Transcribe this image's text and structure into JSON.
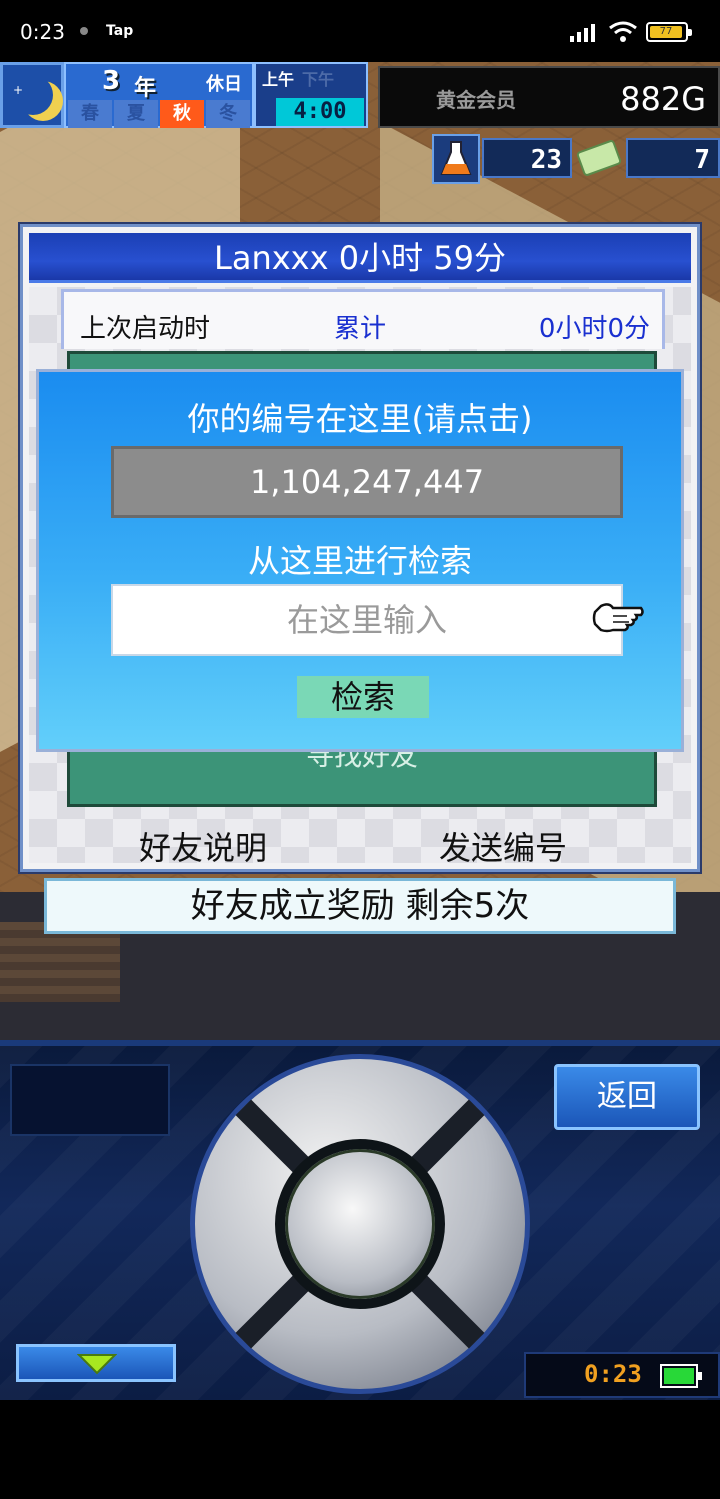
{
  "status_bar": {
    "time": "0:23",
    "app_label": "Tap",
    "battery_level": "77",
    "battery_color": "#f0c020"
  },
  "hud": {
    "year": "3",
    "year_unit": "年",
    "holiday": "休日",
    "seasons": [
      "春",
      "夏",
      "秋",
      "冬"
    ],
    "active_season": "秋",
    "am": "上午",
    "pm": "下午",
    "clock": "4:00",
    "member_status": "黄金会员",
    "gold": "882G",
    "research_points": "23",
    "tickets": "7"
  },
  "friend_panel": {
    "title": "Lanxxx  0小时 59分",
    "last_launch_label": "上次启动时",
    "total_label": "累计",
    "total_value": "0小时0分",
    "find_friend_label": "寻找好友",
    "explain_button": "好友说明",
    "send_id_button": "发送编号"
  },
  "bonus_bar": {
    "text": "好友成立奖励  剩余5次"
  },
  "search_dialog": {
    "title": "你的编号在这里(请点击)",
    "player_id": "1,104,247,447",
    "search_label": "从这里进行检索",
    "input_placeholder": "在这里输入",
    "search_button": "检索"
  },
  "controller": {
    "back_button": "返回",
    "timer": "0:23",
    "battery_color": "#28d838"
  },
  "icons": {
    "moon": "moon-icon",
    "flask": "flask-icon",
    "ticket": "ticket-icon",
    "hand": "pointing-hand-icon",
    "down_arrow": "down-arrow-icon"
  }
}
